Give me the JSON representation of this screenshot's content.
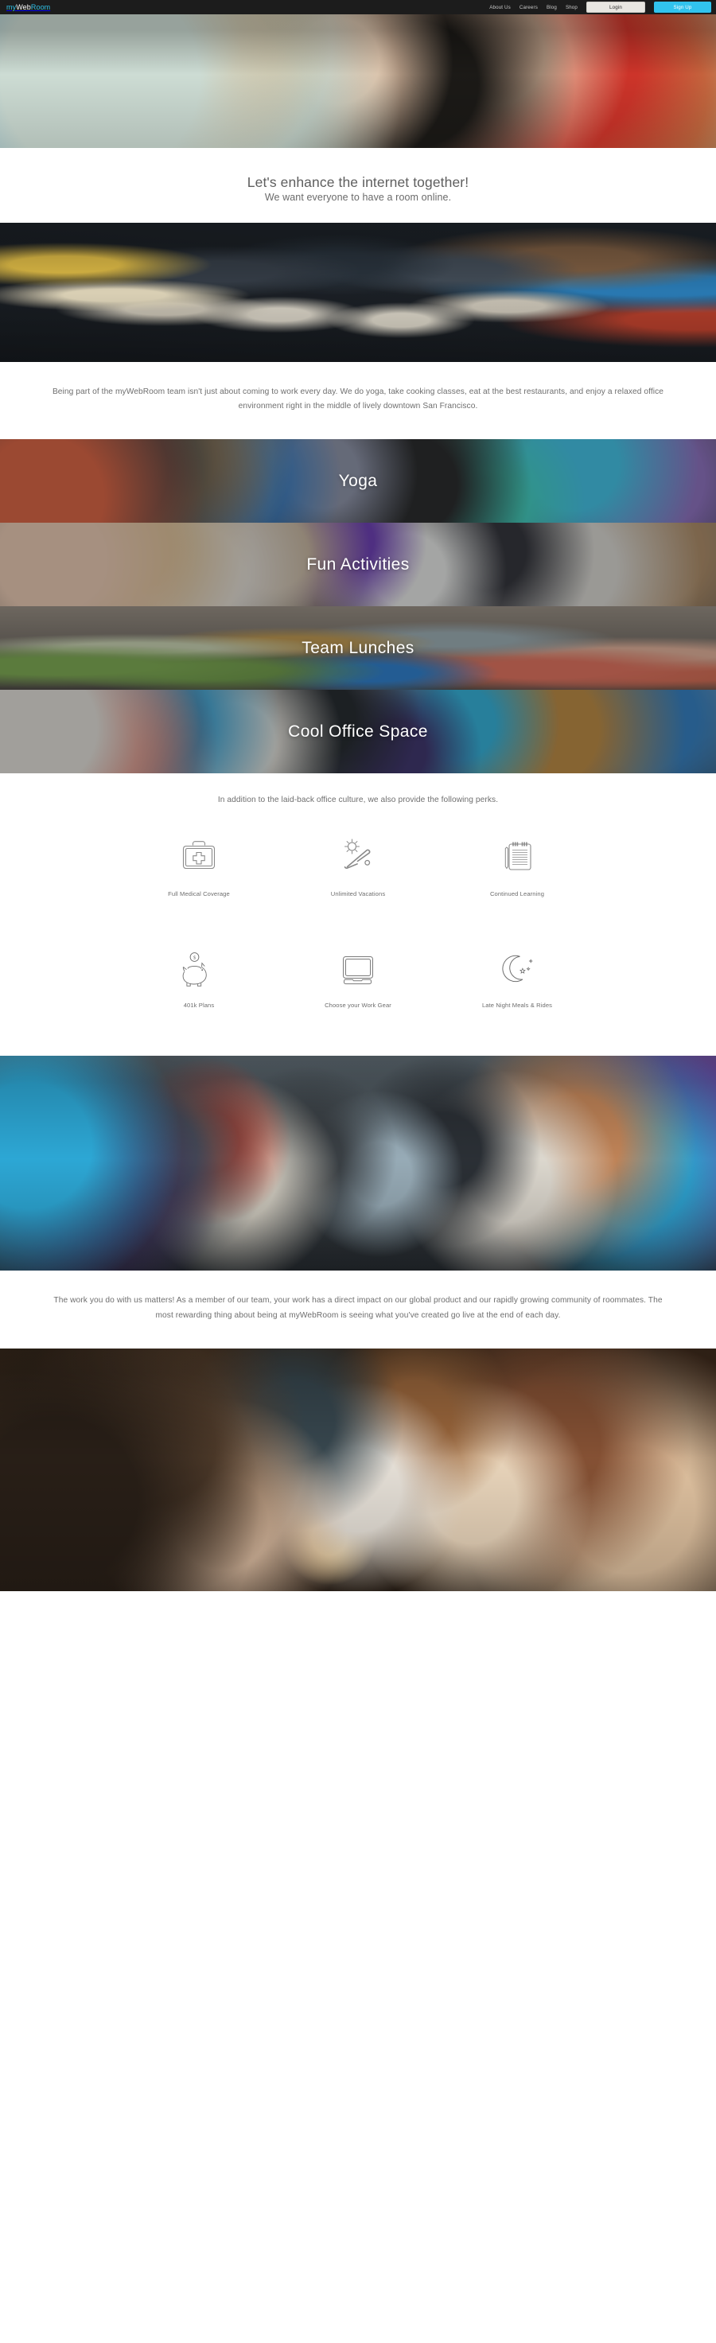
{
  "nav": {
    "logo": {
      "part1": "my",
      "part2": "Web",
      "part3": "Room"
    },
    "links": [
      {
        "label": "About Us"
      },
      {
        "label": "Careers"
      },
      {
        "label": "Blog"
      },
      {
        "label": "Shop"
      }
    ],
    "login_label": "Login",
    "signup_label": "Sign Up",
    "colors": {
      "bar": "#1c1c1c",
      "accent": "#31c3ee",
      "login_bg": "#e8e6e1"
    }
  },
  "intro": {
    "headline": "Let's enhance the internet together!",
    "subhead": "We want everyone to have a room online."
  },
  "about": {
    "paragraph": "Being part of the myWebRoom team isn't just about coming to work every day. We do yoga, take cooking classes, eat at the best restaurants, and enjoy a relaxed office environment right in the middle of lively downtown San Francisco."
  },
  "banners": [
    {
      "label": "Yoga",
      "image": "yoga-photo"
    },
    {
      "label": "Fun Activities",
      "image": "cooking-class-photo"
    },
    {
      "label": "Team Lunches",
      "image": "buffet-photo"
    },
    {
      "label": "Cool Office Space",
      "image": "office-photo"
    }
  ],
  "perks": {
    "lead": "In addition to the laid-back office culture, we also provide the following perks.",
    "items": [
      {
        "label": "Full Medical Coverage",
        "icon": "medical-kit-icon"
      },
      {
        "label": "Unlimited Vacations",
        "icon": "sun-lounger-icon"
      },
      {
        "label": "Continued Learning",
        "icon": "notepad-pen-icon"
      },
      {
        "label": "401k Plans",
        "icon": "piggy-bank-icon"
      },
      {
        "label": "Choose your Work Gear",
        "icon": "monitor-icon"
      },
      {
        "label": "Late Night Meals & Rides",
        "icon": "moon-stars-icon"
      }
    ]
  },
  "impact": {
    "paragraph": "The work you do with us matters! As a member of our team, your work has a direct impact on our global product and our rapidly growing community of roommates. The most rewarding thing about being at myWebRoom is seeing what you've created go live at the end of each day."
  },
  "photos": {
    "hero": "hero-office-photo",
    "team": "team-group-photo",
    "holiday": "holiday-party-photo",
    "dinner": "team-dinner-photo"
  }
}
